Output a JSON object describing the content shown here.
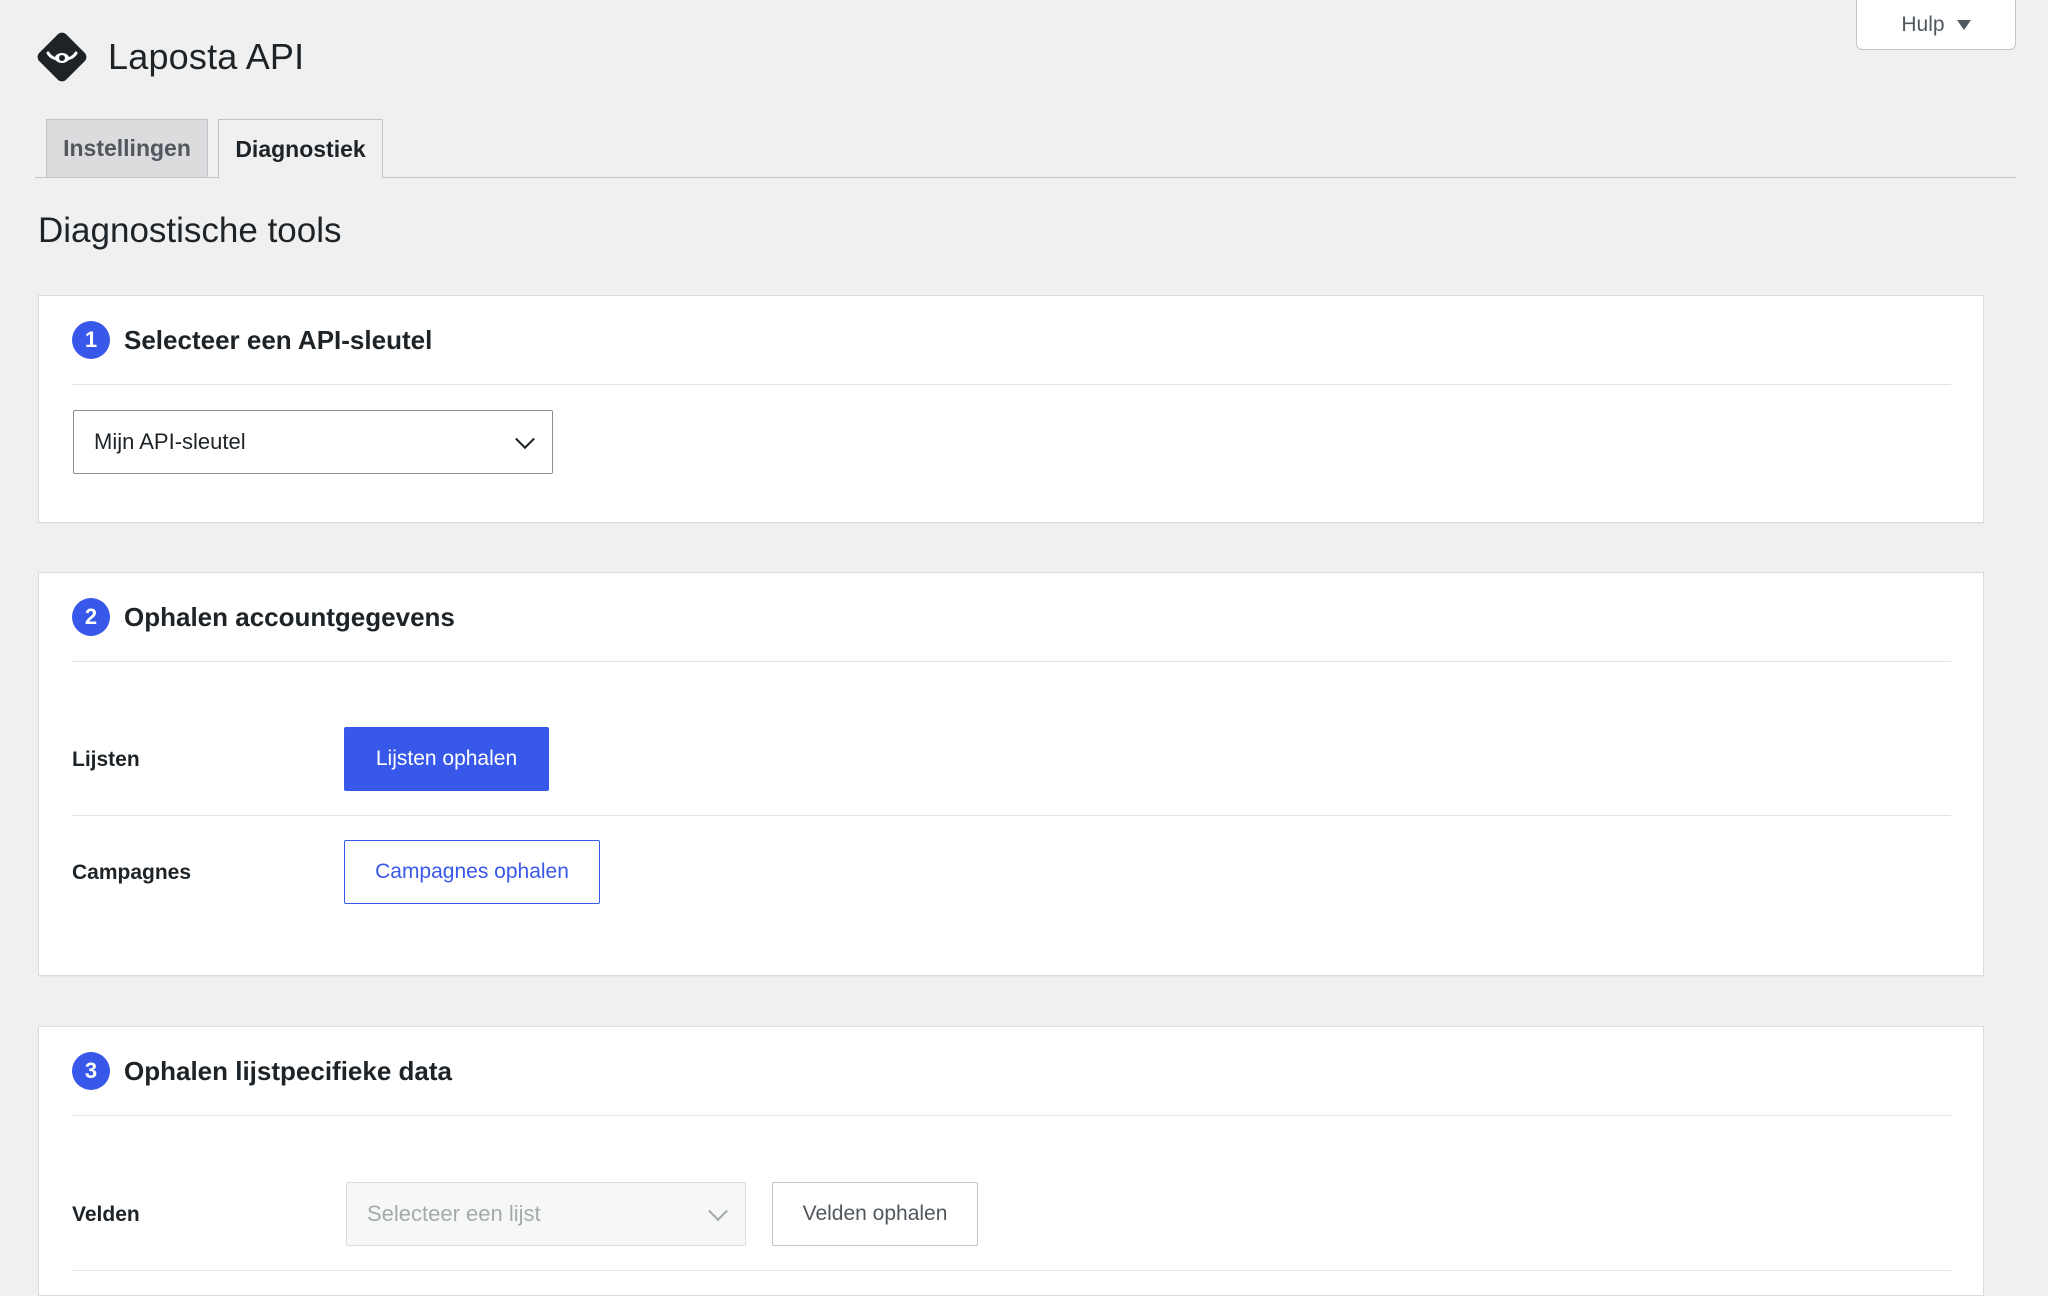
{
  "header": {
    "title": "Laposta API",
    "help_label": "Hulp",
    "logo_icon": "laposta-logo-icon"
  },
  "tabs": [
    {
      "label": "Instellingen",
      "active": false
    },
    {
      "label": "Diagnostiek",
      "active": true
    }
  ],
  "page": {
    "title": "Diagnostische tools"
  },
  "colors": {
    "accent": "#3858e9",
    "background": "#f0f0f1"
  },
  "step1": {
    "number": "1",
    "title": "Selecteer een API-sleutel",
    "select_value": "Mijn API-sleutel"
  },
  "step2": {
    "number": "2",
    "title": "Ophalen accountgegevens",
    "rows": [
      {
        "label": "Lijsten",
        "button": "Lijsten ophalen"
      },
      {
        "label": "Campagnes",
        "button": "Campagnes ophalen"
      }
    ]
  },
  "step3": {
    "number": "3",
    "title": "Ophalen lijstpecifieke data",
    "rows": [
      {
        "label": "Velden",
        "select_placeholder": "Selecteer een lijst",
        "button": "Velden ophalen"
      }
    ]
  }
}
